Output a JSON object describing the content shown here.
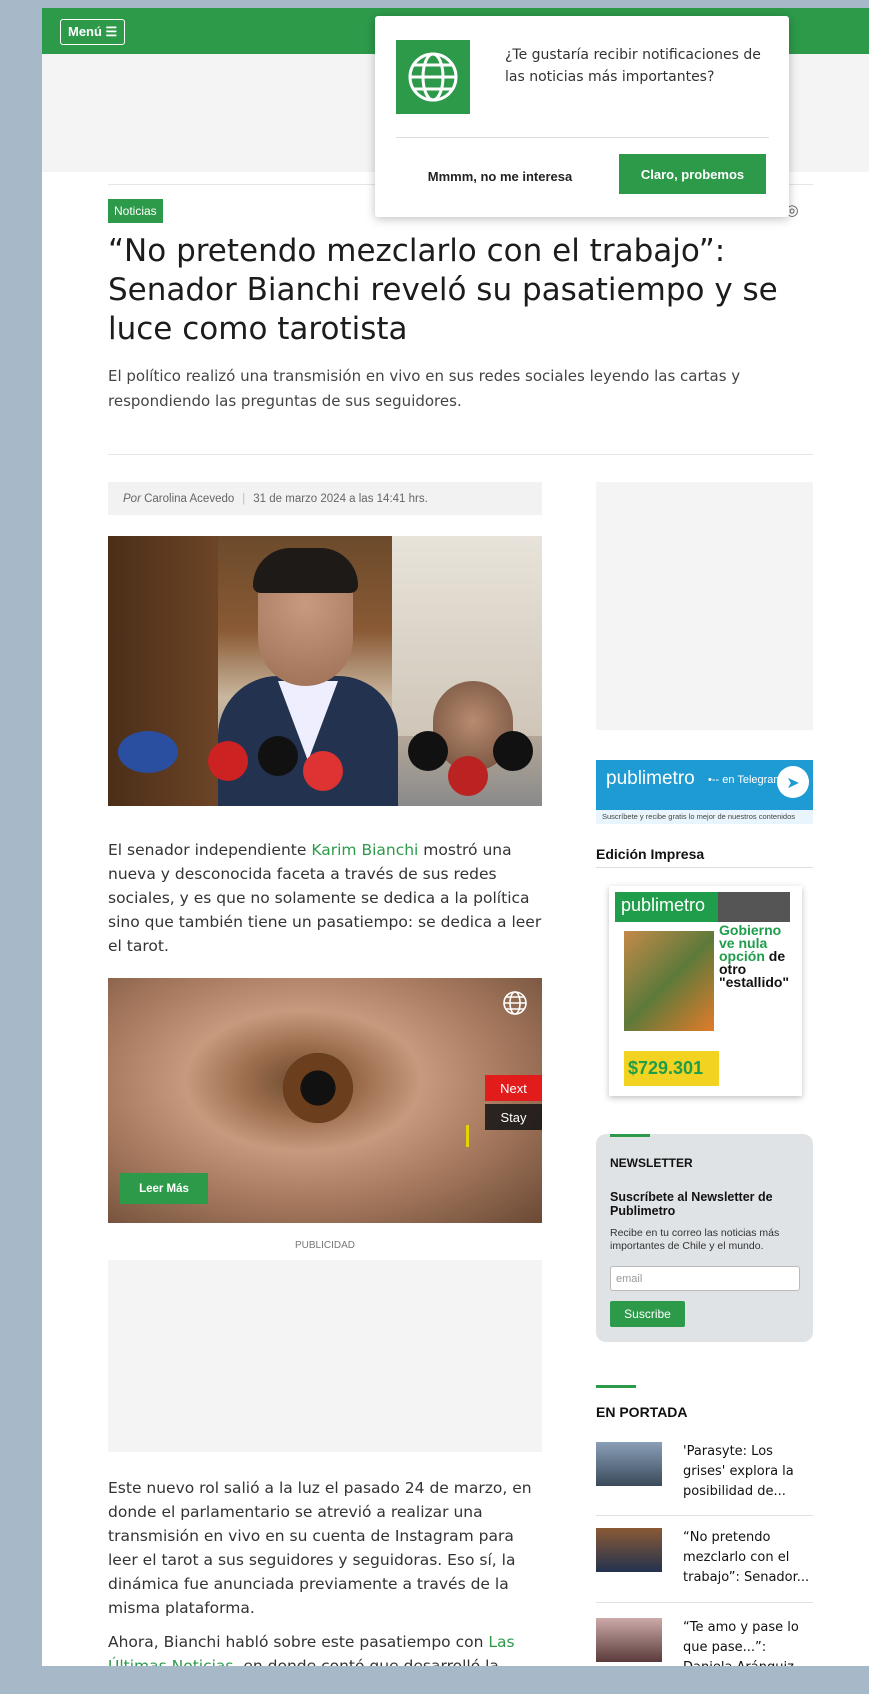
{
  "header": {
    "menu_label": "Menú ☰"
  },
  "notification": {
    "message": "¿Te gustaría recibir notificaciones de las noticias más importantes?",
    "decline_label": "Mmmm, no me interesa",
    "accept_label": "Claro, probemos"
  },
  "article": {
    "section": "Noticias",
    "share_icons": [
      "✉",
      "f",
      "𝕏",
      "◎"
    ],
    "title": "“No pretendo mezclarlo con el trabajo”: Senador Bianchi reveló su pasatiempo y se luce como tarotista",
    "subtitle": "El político realizó una transmisión en vivo en sus redes sociales leyendo las cartas y respondiendo las preguntas de sus seguidores.",
    "byline_por": "Por",
    "author": "Carolina Acevedo",
    "date": "31 de marzo 2024 a las 14:41 hrs.",
    "p1_before": "El senador independiente ",
    "p1_link": "Karim Bianchi",
    "p1_after": " mostró una nueva y desconocida faceta a través de sus redes sociales, y es que no solamente se dedica a la política sino que también tiene un pasatiempo: se dedica a leer el tarot.",
    "p2": "Este nuevo rol salió a la luz el pasado 24 de marzo, en donde el parlamentario se atrevió a realizar una transmisión en vivo en su cuenta de Instagram para leer el tarot a sus seguidores y seguidoras. Eso sí, la dinámica fue anunciada previamente a través de la misma plataforma.",
    "p3_before": "Ahora, Bianchi habló sobre este pasatiempo con ",
    "p3_link": "Las Últimas Noticias",
    "p3_after": ", en donde contó que desarrolló la"
  },
  "ad": {
    "next_label": "Next",
    "stay_label": "Stay",
    "read_more_label": "Leer Más",
    "publicidad_label": "PUBLICIDAD"
  },
  "sidebar": {
    "telegram": {
      "brand": "publimetro",
      "channel": "•-- en Telegram",
      "tagline": "Suscríbete y recibe gratis lo mejor de nuestros contenidos"
    },
    "edicion_title": "Edición Impresa",
    "cover": {
      "masthead": "publimetro",
      "headline_green": "Gobierno ve nula opción",
      "headline_black": "de otro \"estallido\"",
      "price": "$729.301"
    },
    "newsletter": {
      "title": "NEWSLETTER",
      "subtitle": "Suscríbete al Newsletter de Publimetro",
      "description": "Recibe en tu correo las noticias más importantes de Chile y el mundo.",
      "email_placeholder": "email",
      "button_label": "Suscribe"
    },
    "portada": {
      "title": "EN PORTADA",
      "items": [
        {
          "text": "'Parasyte: Los grises' explora la posibilidad de..."
        },
        {
          "text": "“No pretendo mezclarlo con el trabajo”: Senador..."
        },
        {
          "text": "“Te amo y pase lo que pase...”: Daniela Aránguiz..."
        }
      ]
    }
  }
}
